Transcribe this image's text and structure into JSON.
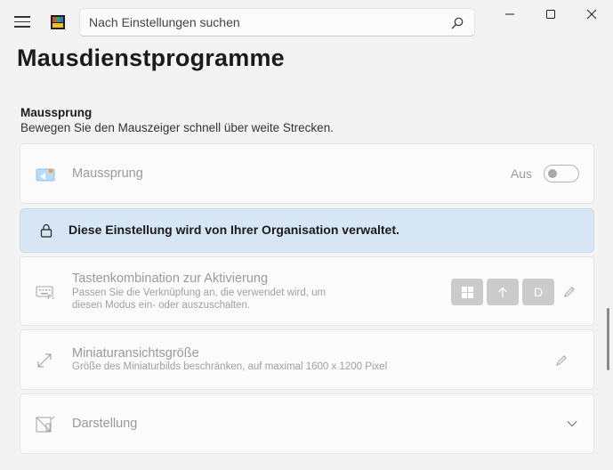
{
  "search": {
    "placeholder": "Nach Einstellungen suchen"
  },
  "page": {
    "title": "Mausdienstprogramme"
  },
  "section": {
    "title": "Maussprung",
    "subtitle": "Bewegen Sie den Mauszeiger schnell über weite Strecken."
  },
  "mouse_jump": {
    "label": "Maussprung",
    "state": "Aus",
    "enabled": false
  },
  "info": {
    "message": "Diese Einstellung wird von Ihrer Organisation verwaltet."
  },
  "shortcut": {
    "label": "Tastenkombination zur Aktivierung",
    "desc_line1": "Passen Sie die Verknüpfung an, die verwendet wird, um",
    "desc_line2": "diesen Modus ein- oder auszuschalten.",
    "keys": [
      "win-key-icon",
      "shift-arrow-icon",
      "D"
    ]
  },
  "thumbnail": {
    "label": "Miniaturansichtsgröße",
    "desc": "Größe des Miniaturbilds beschränken, auf maximal 1600 x 1200 Pixel"
  },
  "appearance": {
    "label": "Darstellung"
  }
}
